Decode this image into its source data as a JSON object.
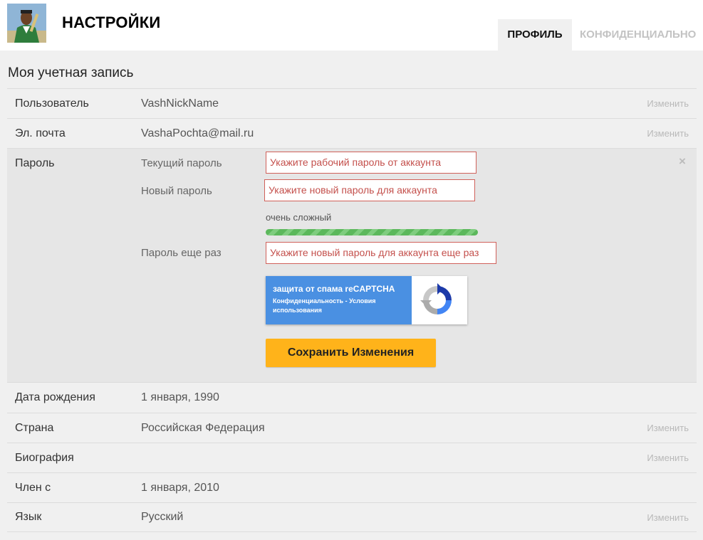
{
  "header": {
    "title": "НАСТРОЙКИ",
    "tabs": [
      {
        "label": "ПРОФИЛЬ",
        "active": true
      },
      {
        "label": "КОНФИДЕНЦИАЛЬНО",
        "active": false
      }
    ]
  },
  "section_title": "Моя учетная запись",
  "rows": {
    "username": {
      "label": "Пользователь",
      "value": "VashNickName",
      "action": "Изменить"
    },
    "email": {
      "label": "Эл. почта",
      "value": "VashaPochta@mail.ru",
      "action": "Изменить"
    },
    "birthdate": {
      "label": "Дата рождения",
      "value": "1 января, 1990"
    },
    "country": {
      "label": "Страна",
      "value": "Российская Федерация",
      "action": "Изменить"
    },
    "bio": {
      "label": "Биография",
      "value": "",
      "action": "Изменить"
    },
    "member_since": {
      "label": "Член с",
      "value": "1 января, 2010"
    },
    "language": {
      "label": "Язык",
      "value": "Русский",
      "action": "Изменить"
    }
  },
  "password": {
    "label": "Пароль",
    "close": "×",
    "current_label": "Текущий пароль",
    "current_placeholder": "Укажите рабочий пароль от аккаунта",
    "new_label": "Новый пароль",
    "new_placeholder": "Укажите новый пароль для аккаунта",
    "strength_text": "очень сложный",
    "strength_fraction": 1.0,
    "repeat_label": "Пароль еще раз",
    "repeat_placeholder": "Укажите новый пароль для аккаунта еще раз",
    "save_label": "Сохранить Изменения"
  },
  "captcha": {
    "title": "защита от спама reCAPTCHA",
    "links": "Конфиденциальность - Условия использования"
  },
  "colors": {
    "accent_button": "#ffb31a",
    "error_border": "#d0615a",
    "strength_green": "#5cb85c",
    "captcha_blue": "#4a90e2"
  },
  "icons": {
    "avatar": "user-avatar",
    "close": "close-icon",
    "captcha_logo": "recaptcha-icon"
  }
}
